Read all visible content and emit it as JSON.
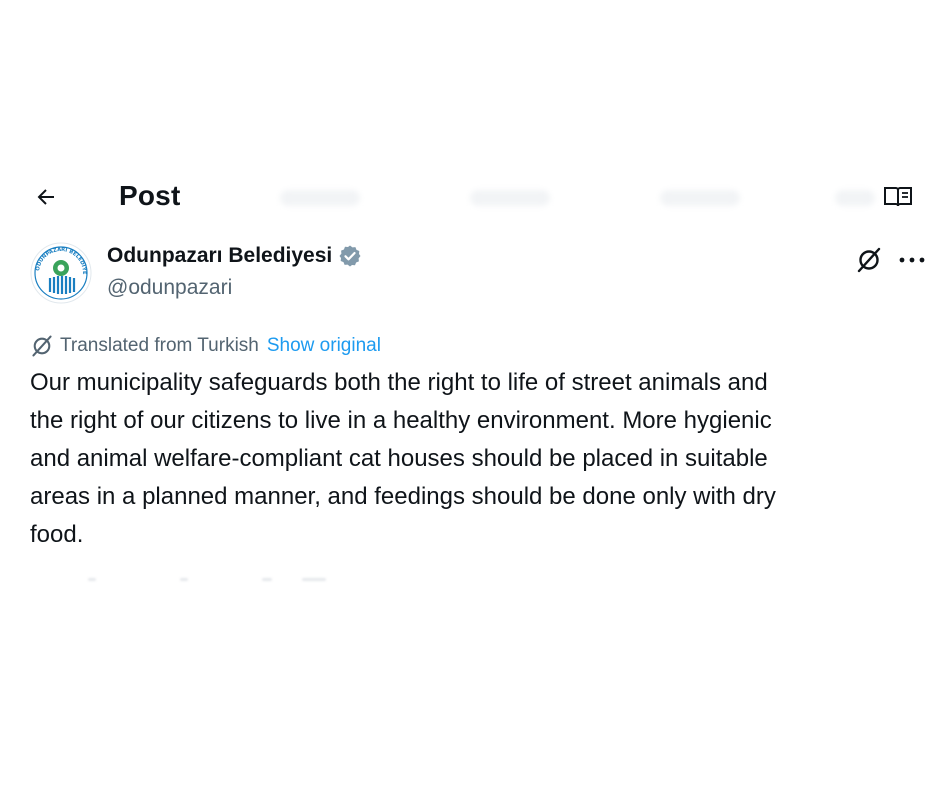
{
  "header": {
    "title": "Post",
    "back_icon": "arrow-left-icon",
    "reader_icon": "reader-mode-icon"
  },
  "author": {
    "display_name": "Odunpazarı Belediyesi",
    "handle": "@odunpazari",
    "verified": true,
    "avatar_icon": "municipality-logo",
    "logo_text": "ODUNPAZARI BELEDİYESİ"
  },
  "actions": {
    "grok_icon": "grok-icon",
    "more_icon": "more-dots-icon"
  },
  "translation": {
    "label": "Translated from Turkish",
    "show_original": "Show original"
  },
  "post": {
    "text": "Our municipality safeguards both the right to life of street animals and\nthe right of our citizens to live in a healthy environment. More hygienic\nand animal welfare-compliant cat houses should be placed in suitable\nareas in a planned manner, and feedings should be done only with dry\nfood."
  },
  "colors": {
    "text": "#0f1419",
    "secondary": "#536471",
    "link": "#1d9bf0",
    "verified_badge": "#829aab",
    "logo_blue": "#1a7fc1",
    "logo_green": "#3aa35b"
  }
}
